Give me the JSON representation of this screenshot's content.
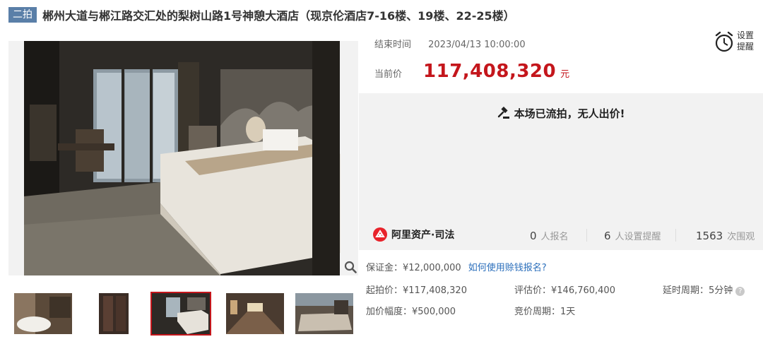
{
  "header": {
    "badge": "二拍",
    "title": "郴州大道与郴江路交汇处的梨树山路1号神憩大酒店（现京伦酒店7-16楼、19楼、22-25楼）"
  },
  "auction": {
    "end_label": "结束时间",
    "end_time": "2023/04/13 10:00:00",
    "price_label": "当前价",
    "price_value": "117,408,320",
    "price_unit": "元",
    "remind_label": "设置提醒",
    "status": "本场已流拍，无人出价!"
  },
  "stats": {
    "brand": "阿里资产·司法",
    "registrants_count": "0",
    "registrants_unit": "人报名",
    "reminders_count": "6",
    "reminders_unit": "人设置提醒",
    "views_count": "1563",
    "views_unit": "次围观"
  },
  "details": {
    "deposit": "保证金：¥12,000,000",
    "deposit_link": "如何使用赊钱报名?",
    "start_price": "起拍价：¥117,408,320",
    "appraisal": "评估价：¥146,760,400",
    "delay": "延时周期：5分钟",
    "increment": "加价幅度：¥500,000",
    "bid_period": "竞价周期：1天"
  },
  "gallery": {
    "active_index": 2,
    "thumb_count": 5
  },
  "colors": {
    "accent_red": "#c4161c",
    "badge_blue": "#5a7fa8",
    "link_blue": "#2a6ebb"
  },
  "icons": {
    "zoom": "magnifier-icon",
    "remind": "alarm-clock-icon",
    "status": "gavel-icon",
    "help": "question-icon",
    "brand": "ali-logo-icon"
  }
}
